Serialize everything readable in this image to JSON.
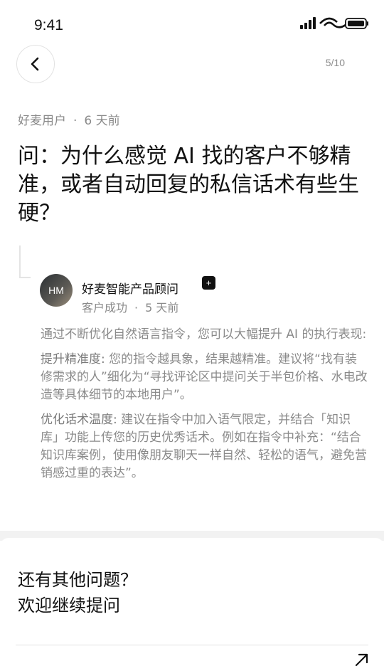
{
  "status_bar": {
    "time": "9:41",
    "icons": [
      "signal-icon",
      "wifi-icon",
      "battery-icon"
    ]
  },
  "header": {
    "back_icon": "chevron-left-icon",
    "page_counter": "5/10"
  },
  "question": {
    "author": "好麦用户",
    "separator": "·",
    "time": "6 天前",
    "title": "问：为什么感觉 AI 找的客户不够精准，或者自动回复的私信话术有些生硬？"
  },
  "answer": {
    "avatar_initials": "HM",
    "author_name": "好麦智能产品顾问",
    "badge": "+",
    "role": "客户成功",
    "separator": "·",
    "time": "5 天前",
    "intro": "通过不断优化自然语言指令，您可以大幅提升 AI 的执行表现:",
    "point1_label": "提升精准度:",
    "point1_text": "  您的指令越具象，结果越精准。建议将“找有装修需求的人”细化为“寻找评论区中提问关于半包价格、水电改造等具体细节的本地用户”。",
    "point2_label": "优化话术温度:",
    "point2_text": "  建议在指令中加入语气限定，并结合「知识库」功能上传您的历史优秀话术。例如在指令中补充：“结合知识库案例，使用像朋友聊天一样自然、轻松的语气，避免营销感过重的表达”。"
  },
  "footer": {
    "line1": "还有其他问题？",
    "line2": "欢迎继续提问",
    "arrow_icon": "arrow-up-right-icon"
  },
  "colors": {
    "text": "#111111",
    "muted": "#8a8a8a",
    "badge": "#111111"
  }
}
